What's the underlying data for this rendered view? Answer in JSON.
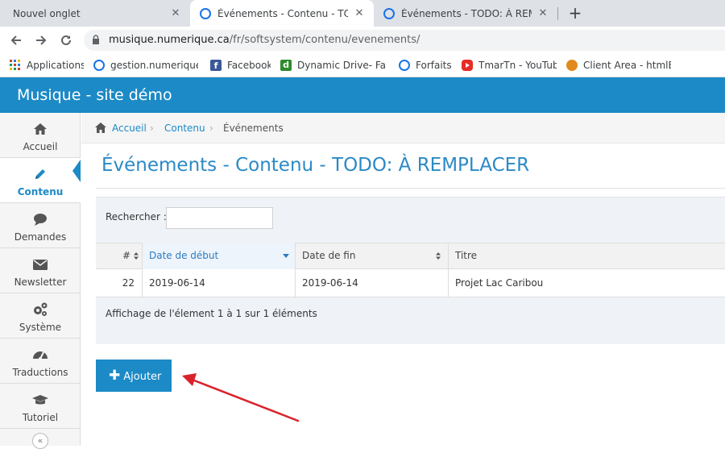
{
  "browser": {
    "tabs": [
      {
        "title": "Nouvel onglet",
        "close": "✕"
      },
      {
        "title": "Événements - Contenu - TODO: À REMPLACER",
        "close": "✕"
      },
      {
        "title": "Événements - TODO: À REMPLACER",
        "close": "✕"
      }
    ],
    "new_tab": "+",
    "url_host": "musique.numerique.ca",
    "url_path": "/fr/softsystem/contenu/evenements/",
    "bookmarks": [
      {
        "label": "Applications",
        "icon": "apps-grid-icon",
        "color": "#c9442f"
      },
      {
        "label": "gestion.numerique.lo",
        "icon": "site-icon",
        "color": "#1a73e8"
      },
      {
        "label": "Facebook",
        "icon": "facebook-icon",
        "color": "#3b5998"
      },
      {
        "label": "Dynamic Drive- Favic",
        "icon": "dynamic-drive-icon",
        "color": "#2e8b2e"
      },
      {
        "label": "Forfaits",
        "icon": "site-icon",
        "color": "#1a73e8"
      },
      {
        "label": "TmarTn - YouTube",
        "icon": "youtube-icon",
        "color": "#e52d27"
      },
      {
        "label": "Client Area - htmlBur",
        "icon": "burger-icon",
        "color": "#e08a1e"
      }
    ]
  },
  "app": {
    "title": "Musique - site démo",
    "accent": "#1c8ac6"
  },
  "sidebar": {
    "items": [
      {
        "label": "Accueil",
        "icon": "home-icon"
      },
      {
        "label": "Contenu",
        "icon": "pencil-icon",
        "active": true
      },
      {
        "label": "Demandes",
        "icon": "speech-bubble-icon"
      },
      {
        "label": "Newsletter",
        "icon": "envelope-icon"
      },
      {
        "label": "Système",
        "icon": "gears-icon"
      },
      {
        "label": "Traductions",
        "icon": "dashboard-icon"
      },
      {
        "label": "Tutoriel",
        "icon": "graduation-cap-icon"
      }
    ],
    "collapse": "«"
  },
  "breadcrumb": {
    "home": "Accueil",
    "section": "Contenu",
    "current": "Événements",
    "separator": "›"
  },
  "page": {
    "title": "Événements - Contenu - TODO: À REMPLACER"
  },
  "table": {
    "search_label": "Rechercher :",
    "search_value": "",
    "columns": [
      "#",
      "Date de début",
      "Date de fin",
      "Titre"
    ],
    "sorted_column": "Date de début",
    "rows": [
      {
        "id": "22",
        "start": "2019-06-14",
        "end": "2019-06-14",
        "title": "Projet Lac Caribou"
      }
    ],
    "info": "Affichage de l'élement 1 à 1 sur 1 éléments"
  },
  "actions": {
    "add_label": "Ajouter",
    "add_icon": "plus-icon"
  },
  "annotation": {
    "arrow_color": "#d9222a"
  }
}
